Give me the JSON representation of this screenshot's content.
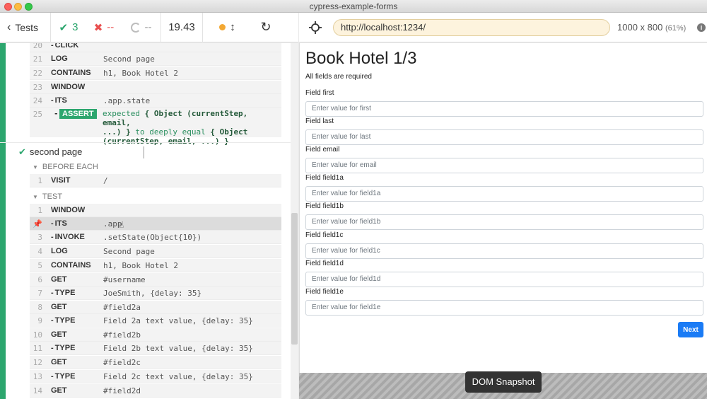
{
  "window": {
    "title": "cypress-example-forms"
  },
  "reporter": {
    "tests_label": "Tests",
    "passed": "3",
    "failed": "--",
    "pending": "--",
    "duration": "19.43",
    "commands_top": [
      {
        "num": "20",
        "name": "CLICK",
        "child": true,
        "msg": ""
      },
      {
        "num": "21",
        "name": "LOG",
        "child": false,
        "msg": "Second page"
      },
      {
        "num": "22",
        "name": "CONTAINS",
        "child": false,
        "msg": "h1, Book Hotel 2"
      },
      {
        "num": "23",
        "name": "WINDOW",
        "child": false,
        "msg": ""
      },
      {
        "num": "24",
        "name": "ITS",
        "child": true,
        "msg": ".app.state"
      }
    ],
    "assert": {
      "num": "25",
      "name": "ASSERT",
      "line1a": "expected",
      "line1b": "{ Object (currentStep, email,",
      "line2a": "...) }",
      "line2b": "to deeply equal",
      "line2c": "{ Object",
      "line3": "(currentStep, email, ...) }"
    },
    "test_title": "second page",
    "before_each_label": "BEFORE EACH",
    "before_each": [
      {
        "num": "1",
        "name": "VISIT",
        "child": false,
        "msg": "/"
      }
    ],
    "test_label": "TEST",
    "test_commands": [
      {
        "num": "1",
        "name": "WINDOW",
        "child": false,
        "msg": ""
      },
      {
        "num": "",
        "name": "ITS",
        "child": true,
        "msg": ".app",
        "pinned": true
      },
      {
        "num": "3",
        "name": "INVOKE",
        "child": true,
        "msg": ".setState(Object{10})"
      },
      {
        "num": "4",
        "name": "LOG",
        "child": false,
        "msg": "Second page"
      },
      {
        "num": "5",
        "name": "CONTAINS",
        "child": false,
        "msg": "h1, Book Hotel 2"
      },
      {
        "num": "6",
        "name": "GET",
        "child": false,
        "msg": "#username"
      },
      {
        "num": "7",
        "name": "TYPE",
        "child": true,
        "msg": "JoeSmith, {delay: 35}"
      },
      {
        "num": "8",
        "name": "GET",
        "child": false,
        "msg": "#field2a"
      },
      {
        "num": "9",
        "name": "TYPE",
        "child": true,
        "msg": "Field 2a text value, {delay: 35}"
      },
      {
        "num": "10",
        "name": "GET",
        "child": false,
        "msg": "#field2b"
      },
      {
        "num": "11",
        "name": "TYPE",
        "child": true,
        "msg": "Field 2b text value, {delay: 35}"
      },
      {
        "num": "12",
        "name": "GET",
        "child": false,
        "msg": "#field2c"
      },
      {
        "num": "13",
        "name": "TYPE",
        "child": true,
        "msg": "Field 2c text value, {delay: 35}"
      },
      {
        "num": "14",
        "name": "GET",
        "child": false,
        "msg": "#field2d"
      }
    ]
  },
  "aut": {
    "url": "http://localhost:1234/",
    "viewport": "1000 x 800",
    "scale": "(61%)",
    "page_title": "Book Hotel 1/3",
    "subtitle": "All fields are required",
    "fields": [
      {
        "label": "Field first",
        "placeholder": "Enter value for first"
      },
      {
        "label": "Field last",
        "placeholder": "Enter value for last"
      },
      {
        "label": "Field email",
        "placeholder": "Enter value for email"
      },
      {
        "label": "Field field1a",
        "placeholder": "Enter value for field1a"
      },
      {
        "label": "Field field1b",
        "placeholder": "Enter value for field1b"
      },
      {
        "label": "Field field1c",
        "placeholder": "Enter value for field1c"
      },
      {
        "label": "Field field1d",
        "placeholder": "Enter value for field1d"
      },
      {
        "label": "Field field1e",
        "placeholder": "Enter value for field1e"
      }
    ],
    "next_label": "Next",
    "snapshot_label": "DOM Snapshot"
  },
  "colors": {
    "pass": "#2ca66e",
    "fail": "#e94f4f",
    "primary": "#1a7bf5",
    "url_bg": "#fdf3dd"
  },
  "icons": [
    "chevron-left-icon",
    "check-icon",
    "x-icon",
    "spinner-icon",
    "running-dot-icon",
    "resize-icon",
    "reload-icon",
    "crosshair-icon",
    "info-icon",
    "pin-icon",
    "caret-down-icon",
    "hand-cursor-icon"
  ]
}
